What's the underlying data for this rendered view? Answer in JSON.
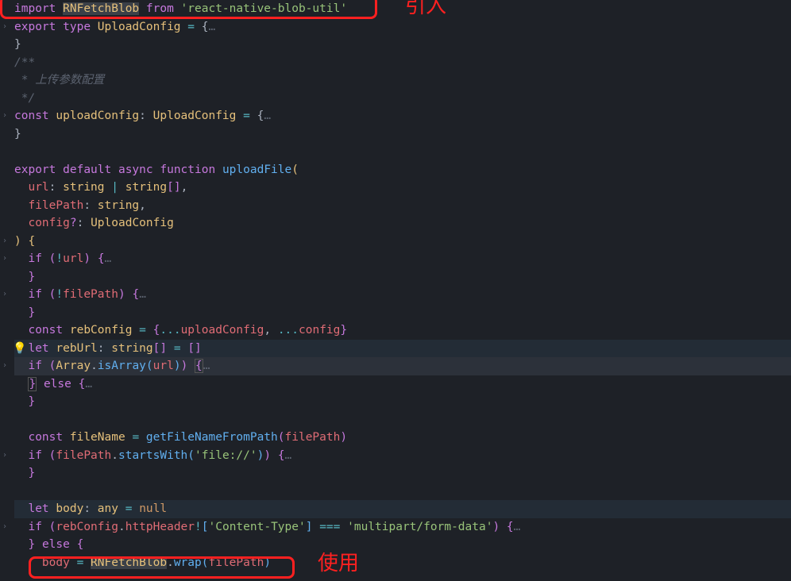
{
  "annotations": {
    "label_import": "引入",
    "label_use": "使用"
  },
  "code": {
    "l1_import": "import",
    "l1_class": "RNFetchBlob",
    "l1_from": "from",
    "l1_str": "'react-native-blob-util'",
    "l2_export": "export",
    "l2_type": "type",
    "l2_name": "UploadConfig",
    "l2_eq": "=",
    "l2_brace": "{",
    "l2_ell": "…",
    "l3_brace": "}",
    "l4_cmt": "/**",
    "l5_cmt": " * 上传参数配置",
    "l6_cmt": " */",
    "l7_const": "const",
    "l7_name": "uploadConfig",
    "l7_type": "UploadConfig",
    "l7_eq": "=",
    "l7_brace": "{",
    "l7_ell": "…",
    "l8_brace": "}",
    "l10_export": "export",
    "l10_default": "default",
    "l10_async": "async",
    "l10_function": "function",
    "l10_name": "uploadFile",
    "l10_paren": "(",
    "l11_p1": "url",
    "l11_t1a": "string",
    "l11_t1b": "string",
    "l11_t1br": "[]",
    "l12_p2": "filePath",
    "l12_t2": "string",
    "l13_p3": "config",
    "l13_opt": "?",
    "l13_t3": "UploadConfig",
    "l14_paren": ")",
    "l14_brace": "{",
    "l15_if": "if",
    "l15_not": "!",
    "l15_var": "url",
    "l15_brace": "{",
    "l15_ell": "…",
    "l16_brace": "}",
    "l17_if": "if",
    "l17_not": "!",
    "l17_var": "filePath",
    "l17_brace": "{",
    "l17_ell": "…",
    "l18_brace": "}",
    "l19_const": "const",
    "l19_name": "rebConfig",
    "l19_eq": "=",
    "l19_spread1": "...",
    "l19_v1": "uploadConfig",
    "l19_spread2": "...",
    "l19_v2": "config",
    "l20_let": "let",
    "l20_name": "rebUrl",
    "l20_type": "string",
    "l20_br": "[]",
    "l20_eq": "=",
    "l20_val": "[]",
    "l21_if": "if",
    "l21_cls": "Array",
    "l21_fn": "isArray",
    "l21_arg": "url",
    "l21_brace": "{",
    "l21_ell": "…",
    "l22_brace": "}",
    "l22_else": "else",
    "l22_brace2": "{",
    "l22_ell": "…",
    "l23_brace": "}",
    "l25_const": "const",
    "l25_name": "fileName",
    "l25_eq": "=",
    "l25_fn": "getFileNameFromPath",
    "l25_arg": "filePath",
    "l26_if": "if",
    "l26_var": "filePath",
    "l26_fn": "startsWith",
    "l26_str": "'file://'",
    "l26_brace": "{",
    "l26_ell": "…",
    "l27_brace": "}",
    "l29_let": "let",
    "l29_name": "body",
    "l29_type": "any",
    "l29_eq": "=",
    "l29_null": "null",
    "l30_if": "if",
    "l30_var": "rebConfig",
    "l30_prop": "httpHeader",
    "l30_bang": "!",
    "l30_key": "'Content-Type'",
    "l30_eqeq": "===",
    "l30_val": "'multipart/form-data'",
    "l30_brace": "{",
    "l30_ell": "…",
    "l31_brace": "}",
    "l31_else": "else",
    "l31_brace2": "{",
    "l32_var": "body",
    "l32_eq": "=",
    "l32_cls": "RNFetchBlob",
    "l32_fn": "wrap",
    "l32_arg": "filePath"
  }
}
